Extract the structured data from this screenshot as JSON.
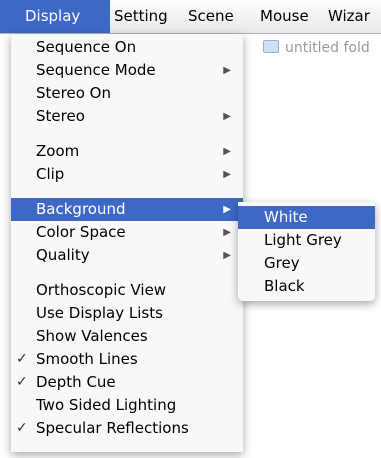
{
  "menubar": {
    "items": [
      {
        "label": "Display"
      },
      {
        "label": "Setting"
      },
      {
        "label": "Scene"
      },
      {
        "label": "Mouse"
      },
      {
        "label": "Wizar"
      }
    ]
  },
  "background_window": {
    "folder_label": "untitled fold"
  },
  "display_menu": {
    "groups": [
      [
        {
          "label": "Sequence On",
          "checked": false,
          "submenu": false
        },
        {
          "label": "Sequence Mode",
          "checked": false,
          "submenu": true
        },
        {
          "label": "Stereo On",
          "checked": false,
          "submenu": false
        },
        {
          "label": "Stereo",
          "checked": false,
          "submenu": true
        }
      ],
      [
        {
          "label": "Zoom",
          "checked": false,
          "submenu": true
        },
        {
          "label": "Clip",
          "checked": false,
          "submenu": true
        }
      ],
      [
        {
          "label": "Background",
          "checked": false,
          "submenu": true
        },
        {
          "label": "Color Space",
          "checked": false,
          "submenu": true
        },
        {
          "label": "Quality",
          "checked": false,
          "submenu": true
        }
      ],
      [
        {
          "label": "Orthoscopic View",
          "checked": false,
          "submenu": false
        },
        {
          "label": "Use Display Lists",
          "checked": false,
          "submenu": false
        },
        {
          "label": "Show Valences",
          "checked": false,
          "submenu": false
        },
        {
          "label": "Smooth Lines",
          "checked": true,
          "submenu": false
        },
        {
          "label": "Depth Cue",
          "checked": true,
          "submenu": false
        },
        {
          "label": "Two Sided Lighting",
          "checked": false,
          "submenu": false
        },
        {
          "label": "Specular Reflections",
          "checked": true,
          "submenu": false
        }
      ]
    ]
  },
  "background_submenu": {
    "items": [
      {
        "label": "White"
      },
      {
        "label": "Light Grey"
      },
      {
        "label": "Grey"
      },
      {
        "label": "Black"
      }
    ]
  },
  "icons": {
    "check": "✓",
    "submenu_arrow": "▶"
  },
  "colors": {
    "highlight": "#3d68c6"
  }
}
